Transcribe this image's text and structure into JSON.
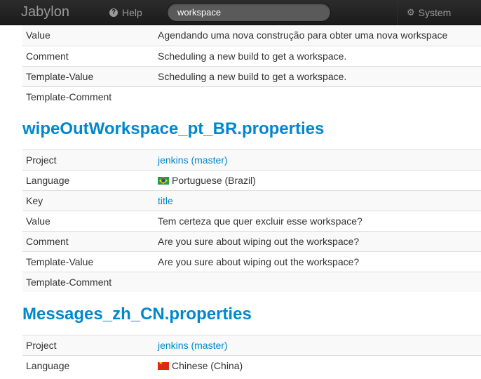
{
  "navbar": {
    "brand": "Jabylon",
    "help_label": "Help",
    "search_value": "workspace",
    "system_label": "System"
  },
  "sections": [
    {
      "rows": [
        {
          "key": "Value",
          "value": "Agendando uma nova construção para obter uma nova workspace"
        },
        {
          "key": "Comment",
          "value": "Scheduling a new build to get a workspace."
        },
        {
          "key": "Template-Value",
          "value": "Scheduling a new build to get a workspace."
        },
        {
          "key": "Template-Comment",
          "value": ""
        }
      ]
    },
    {
      "title": "wipeOutWorkspace_pt_BR.properties",
      "rows": [
        {
          "key": "Project",
          "value": "jenkins (master)"
        },
        {
          "key": "Language",
          "value": "Portuguese (Brazil)"
        },
        {
          "key": "Key",
          "value": "title"
        },
        {
          "key": "Value",
          "value": "Tem certeza que quer excluir esse workspace?"
        },
        {
          "key": "Comment",
          "value": "Are you sure about wiping out the workspace?"
        },
        {
          "key": "Template-Value",
          "value": "Are you sure about wiping out the workspace?"
        },
        {
          "key": "Template-Comment",
          "value": ""
        }
      ]
    },
    {
      "title": "Messages_zh_CN.properties",
      "rows": [
        {
          "key": "Project",
          "value": "jenkins (master)"
        },
        {
          "key": "Language",
          "value": "Chinese (China)"
        }
      ]
    }
  ],
  "icons": {
    "help": "question-circle-icon",
    "system": "gear-icon",
    "flag_br": "flag-brazil-icon",
    "flag_cn": "flag-china-icon"
  },
  "colors": {
    "link": "#0088cc",
    "navbar_bg": "#1b1b1b",
    "nav_text": "#999999"
  }
}
